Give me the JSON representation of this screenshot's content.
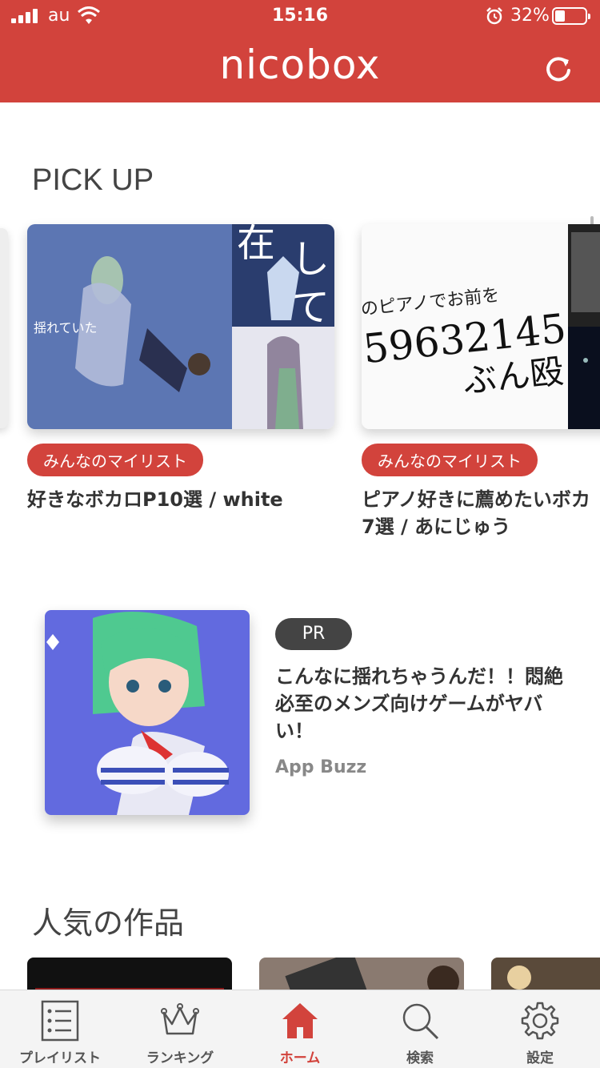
{
  "status_bar": {
    "carrier": "au",
    "time": "15:16",
    "battery_percent": "32%",
    "battery_level": 0.32
  },
  "header": {
    "app_title": "nicobox"
  },
  "pickup": {
    "section_title": "PICK UP",
    "cards": [
      {
        "badge": "みんなのマイリスト",
        "title": "好きなボカロP10選 / white"
      },
      {
        "badge": "みんなのマイリスト",
        "title": "ピアノ好きに薦めたいボカ\n7選 / あにじゅう",
        "thumb_text_line1": "のピアノでお前を",
        "thumb_text_line2": "59632145",
        "thumb_text_line3": "ぶん殴"
      }
    ],
    "card1_thumb_overlay": "揺れていた"
  },
  "ad": {
    "pr_label": "PR",
    "title": "こんなに揺れちゃうんだ！！悶絶必至のメンズ向けゲームがヤバい！",
    "source": "App Buzz"
  },
  "popular": {
    "section_title": "人気の作品"
  },
  "tabbar": {
    "tabs": [
      {
        "label": "プレイリスト",
        "icon": "playlist-icon"
      },
      {
        "label": "ランキング",
        "icon": "crown-icon"
      },
      {
        "label": "ホーム",
        "icon": "home-icon",
        "active": true
      },
      {
        "label": "検索",
        "icon": "search-icon"
      },
      {
        "label": "設定",
        "icon": "gear-icon"
      }
    ]
  },
  "colors": {
    "brand_red": "#d2433c",
    "ad_badge": "#444444",
    "inactive_tab": "#555555"
  }
}
